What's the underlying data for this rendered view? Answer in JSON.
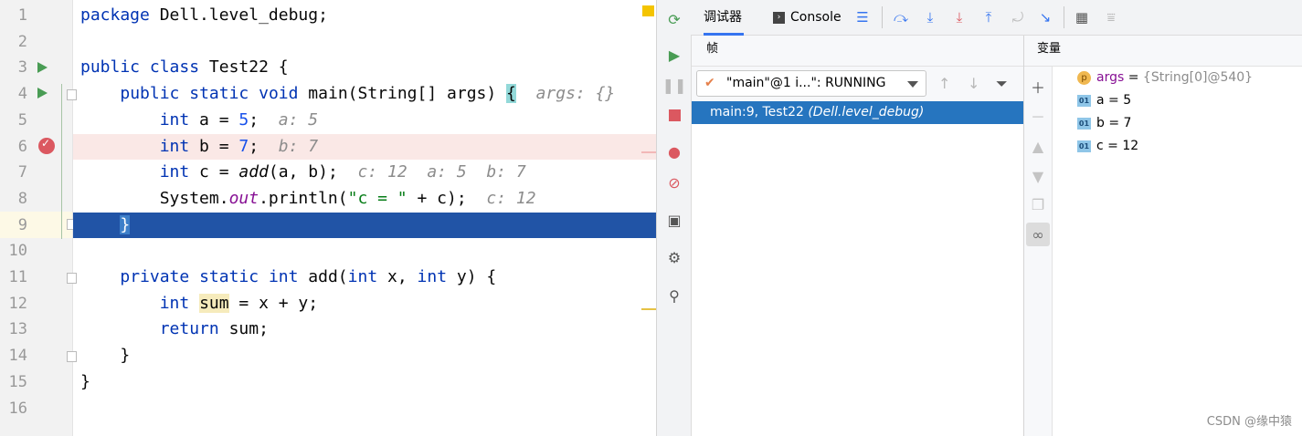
{
  "editor": {
    "line_numbers": [
      "1",
      "2",
      "3",
      "4",
      "5",
      "6",
      "7",
      "8",
      "9",
      "10",
      "11",
      "12",
      "13",
      "14",
      "15",
      "16"
    ],
    "code": {
      "l1_kw": "package",
      "l1_rest": " Dell.level_debug;",
      "l3_kw1": "public",
      "l3_kw2": "class",
      "l3_rest": " Test22 {",
      "l4_kw1": "public",
      "l4_kw2": "static",
      "l4_kw3": "void",
      "l4_name": " main(String[] args) ",
      "l4_brace": "{",
      "l4_hint": "args: {}",
      "l5_kw": "int",
      "l5_a": " a = ",
      "l5_num": "5",
      "l5_semi": ";",
      "l5_hint": "a: 5",
      "l6_kw": "int",
      "l6_a": " b = ",
      "l6_num": "7",
      "l6_semi": ";",
      "l6_hint": "b: 7",
      "l7_kw": "int",
      "l7_a": " c = ",
      "l7_call": "add",
      "l7_rest": "(a, b);",
      "l7_hint": "c: 12  a: 5  b: 7",
      "l8_a": "System.",
      "l8_out": "out",
      "l8_b": ".println(",
      "l8_str": "\"c = \"",
      "l8_c": " + c);",
      "l8_hint": "c: 12",
      "l9_brace": "}",
      "l11_kw1": "private",
      "l11_kw2": "static",
      "l11_kw3": "int",
      "l11_name": " add(",
      "l11_kw4": "int",
      "l11_x": " x, ",
      "l11_kw5": "int",
      "l11_y": " y) {",
      "l12_kw": "int",
      "l12_sum": "sum",
      "l12_rest": " = x + y;",
      "l13_kw": "return",
      "l13_rest": " sum;",
      "l14": "}",
      "l15": "}"
    }
  },
  "debugger": {
    "tabs": {
      "debugger_label": "调试器",
      "console_label": "Console"
    },
    "frames": {
      "header": "帧",
      "thread_selected": "\"main\"@1 i...\": RUNNING",
      "selected_frame_main": "main:9, Test22 ",
      "selected_frame_pkg": "(Dell.level_debug)"
    },
    "variables": {
      "header": "变量",
      "items": [
        {
          "badge": "p",
          "name": "args",
          "eq": " = ",
          "value": "{String[0]@540}"
        },
        {
          "badge": "01",
          "name": "a",
          "eq": " = ",
          "value": "5"
        },
        {
          "badge": "01",
          "name": "b",
          "eq": " = ",
          "value": "7"
        },
        {
          "badge": "01",
          "name": "c",
          "eq": " = ",
          "value": "12"
        }
      ]
    }
  },
  "watermark": "CSDN @缘中猿",
  "colors": {
    "keyword": "#0033b3",
    "number": "#1750eb",
    "selection": "#2154a6",
    "frame_selection": "#2675bf",
    "breakpoint": "#db5860"
  }
}
